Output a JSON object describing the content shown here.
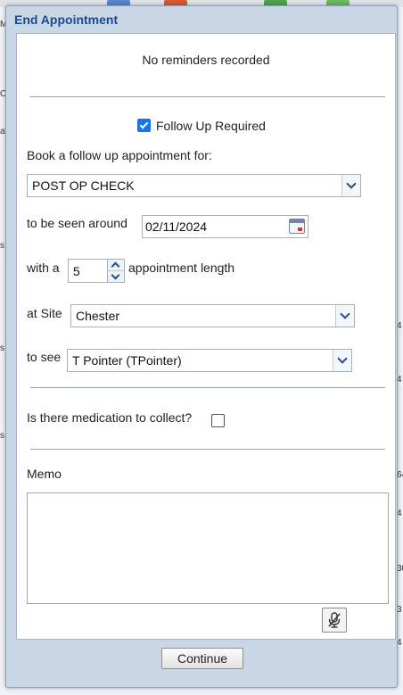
{
  "dialog": {
    "title": "End Appointment",
    "reminders_text": "No reminders recorded",
    "follow_up_label": "Follow Up Required",
    "follow_up_checked": true,
    "book_label": "Book a follow up appointment for:",
    "appointment_type": "POST OP CHECK",
    "seen_around_label": "to be seen around",
    "date_value": "02/11/2024",
    "with_a_label": "with a",
    "length_value": "5",
    "length_label": "appointment length",
    "site_label": "at Site",
    "site_value": "Chester",
    "see_label": "to see",
    "clinician_value": "T Pointer (TPointer)",
    "medication_label": "Is there medication to collect?",
    "medication_checked": false,
    "memo_label": "Memo",
    "memo_value": "",
    "continue_label": "Continue"
  },
  "background": {
    "fragments": [
      "M",
      "C",
      "av",
      "s",
      "s",
      "s",
      "64",
      "4",
      "4",
      "30",
      "3",
      "4",
      "4"
    ]
  },
  "icons": {
    "calendar": "calendar-icon",
    "microphone_muted": "microphone-muted-icon",
    "dropdown": "chevron-down-icon"
  },
  "colors": {
    "title": "#1a4b8c",
    "checkbox_checked": "#1a73e8",
    "dialog_frame": "#c9d6e6"
  }
}
